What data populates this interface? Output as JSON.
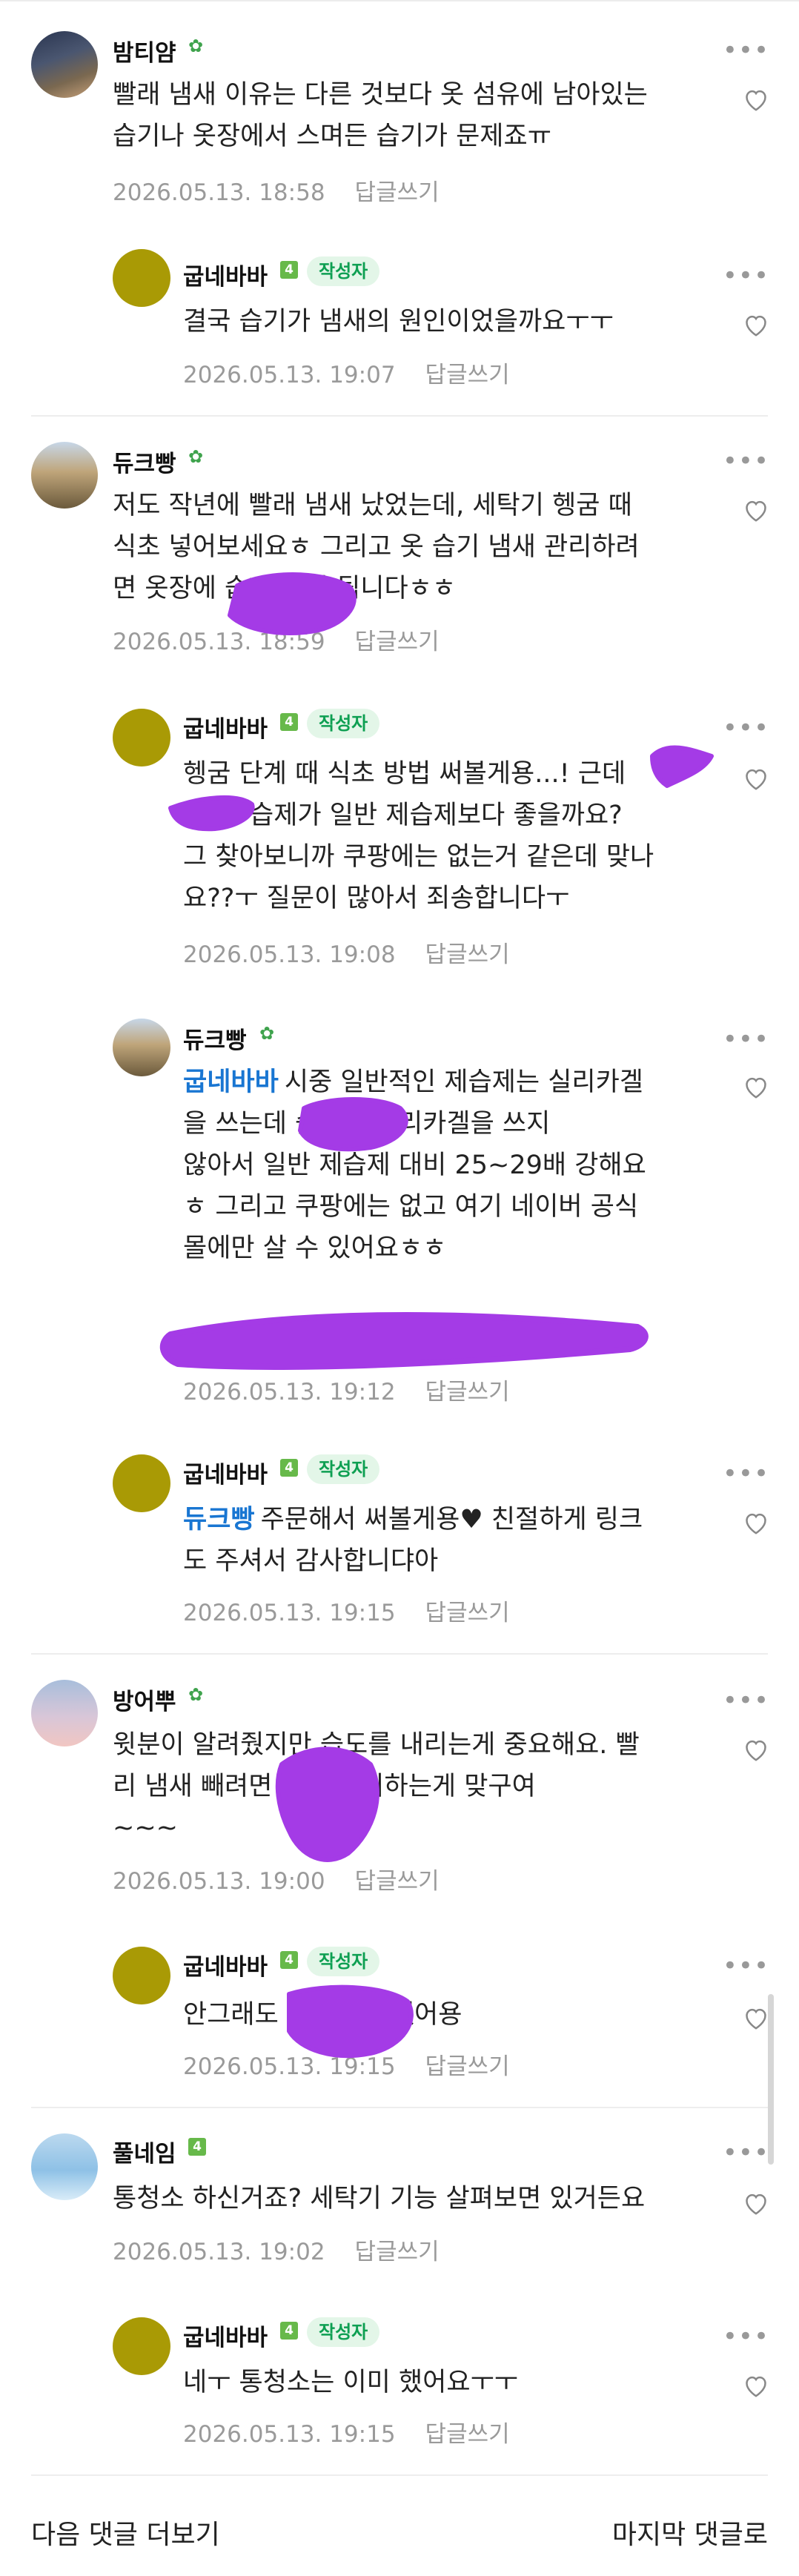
{
  "comments": [
    {
      "author": "밤티얌",
      "level_icon": "sprout",
      "is_writer": false,
      "reply": false,
      "text_lines": [
        "빨래 냄새 이유는 다른 것보다 옷 섬유에 남아있는",
        "습기나 옷장에서 스며든 습기가 문제죠ㅠ"
      ],
      "date": "2026.05.13. 18:58",
      "reply_label": "답글쓰기"
    },
    {
      "author": "굽네바바",
      "level": "4",
      "is_writer": true,
      "writer_label": "작성자",
      "reply": true,
      "text_lines": [
        "결국 습기가 냄새의 원인이었을까요ㅜㅜ"
      ],
      "date": "2026.05.13. 19:07",
      "reply_label": "답글쓰기"
    },
    {
      "author": "듀크빵",
      "level_icon": "sprout",
      "is_writer": false,
      "reply": false,
      "text_lines": [
        "저도 작년에 빨래 냄새 났었는데, 세탁기 헹굼 때",
        "식초 넣어보세요ㅎ 그리고 옷 습기 냄새 관리하려",
        "면 옷장에 습제 두면 됩니다ㅎㅎ"
      ],
      "date": "2026.05.13. 18:59",
      "reply_label": "답글쓰기"
    },
    {
      "author": "굽네바바",
      "level": "4",
      "is_writer": true,
      "writer_label": "작성자",
      "reply": true,
      "text_lines": [
        "헹굼 단계 때 식초 방법 써볼게용...! 근데",
        "습제가 일반 제습제보다 좋을까요?",
        "그 찾아보니까 쿠팡에는 없는거 같은데 맞나",
        "요??ㅜ 질문이 많아서 죄송합니다ㅜ"
      ],
      "date": "2026.05.13. 19:08",
      "reply_label": "답글쓰기"
    },
    {
      "author": "듀크빵",
      "level_icon": "sprout",
      "is_writer": false,
      "reply": true,
      "mention": "굽네바바",
      "text_lines": [
        "시중 일반적인 제습제는 실리카겔",
        "을 쓰는데 습제는 실리카겔을 쓰지",
        "않아서 일반 제습제 대비 25~29배 강해요",
        "ㅎ 그리고 쿠팡에는 없고 여기 네이버 공식",
        "몰에만 살 수 있어요ㅎㅎ"
      ],
      "date": "2026.05.13. 19:12",
      "reply_label": "답글쓰기"
    },
    {
      "author": "굽네바바",
      "level": "4",
      "is_writer": true,
      "writer_label": "작성자",
      "reply": true,
      "mention": "듀크빵",
      "text_lines": [
        "주문해서 써볼게용♥ 친절하게 링크",
        "도 주셔서 감사합니댜아"
      ],
      "date": "2026.05.13. 19:15",
      "reply_label": "답글쓰기"
    },
    {
      "author": "방어뿌",
      "level_icon": "sprout",
      "is_writer": false,
      "reply": false,
      "text_lines": [
        "윗분이 알려줬지만 습도를 내리는게 중요해요. 빨",
        "리 냄새 빼려면 습제 배치하는게 맞구여",
        "~~~"
      ],
      "date": "2026.05.13. 19:00",
      "reply_label": "답글쓰기"
    },
    {
      "author": "굽네바바",
      "level": "4",
      "is_writer": true,
      "writer_label": "작성자",
      "reply": true,
      "text_lines": [
        "안그래도 방금 주문했어용"
      ],
      "date": "2026.05.13. 19:15",
      "reply_label": "답글쓰기"
    },
    {
      "author": "풀네임",
      "level": "4",
      "is_writer": false,
      "reply": false,
      "text_lines": [
        "통청소 하신거죠? 세탁기 기능 살펴보면 있거든요"
      ],
      "date": "2026.05.13. 19:02",
      "reply_label": "답글쓰기"
    },
    {
      "author": "굽네바바",
      "level": "4",
      "is_writer": true,
      "writer_label": "작성자",
      "reply": true,
      "text_lines": [
        "네ㅜ 통청소는 이미 했어요ㅜㅜ"
      ],
      "date": "2026.05.13. 19:15",
      "reply_label": "답글쓰기"
    }
  ],
  "footer": {
    "more_label": "다음 댓글 더보기",
    "last_label": "마지막 댓글로"
  },
  "colors": {
    "accent": "#0e9f52",
    "mention": "#1976d2",
    "redaction": "#a43be6",
    "writer_avatar": "#a99a05"
  },
  "icons": {
    "like": "heart-outline-icon",
    "more": "kebab-icon",
    "level": "level-badge-icon",
    "sprout": "sprout-icon"
  }
}
